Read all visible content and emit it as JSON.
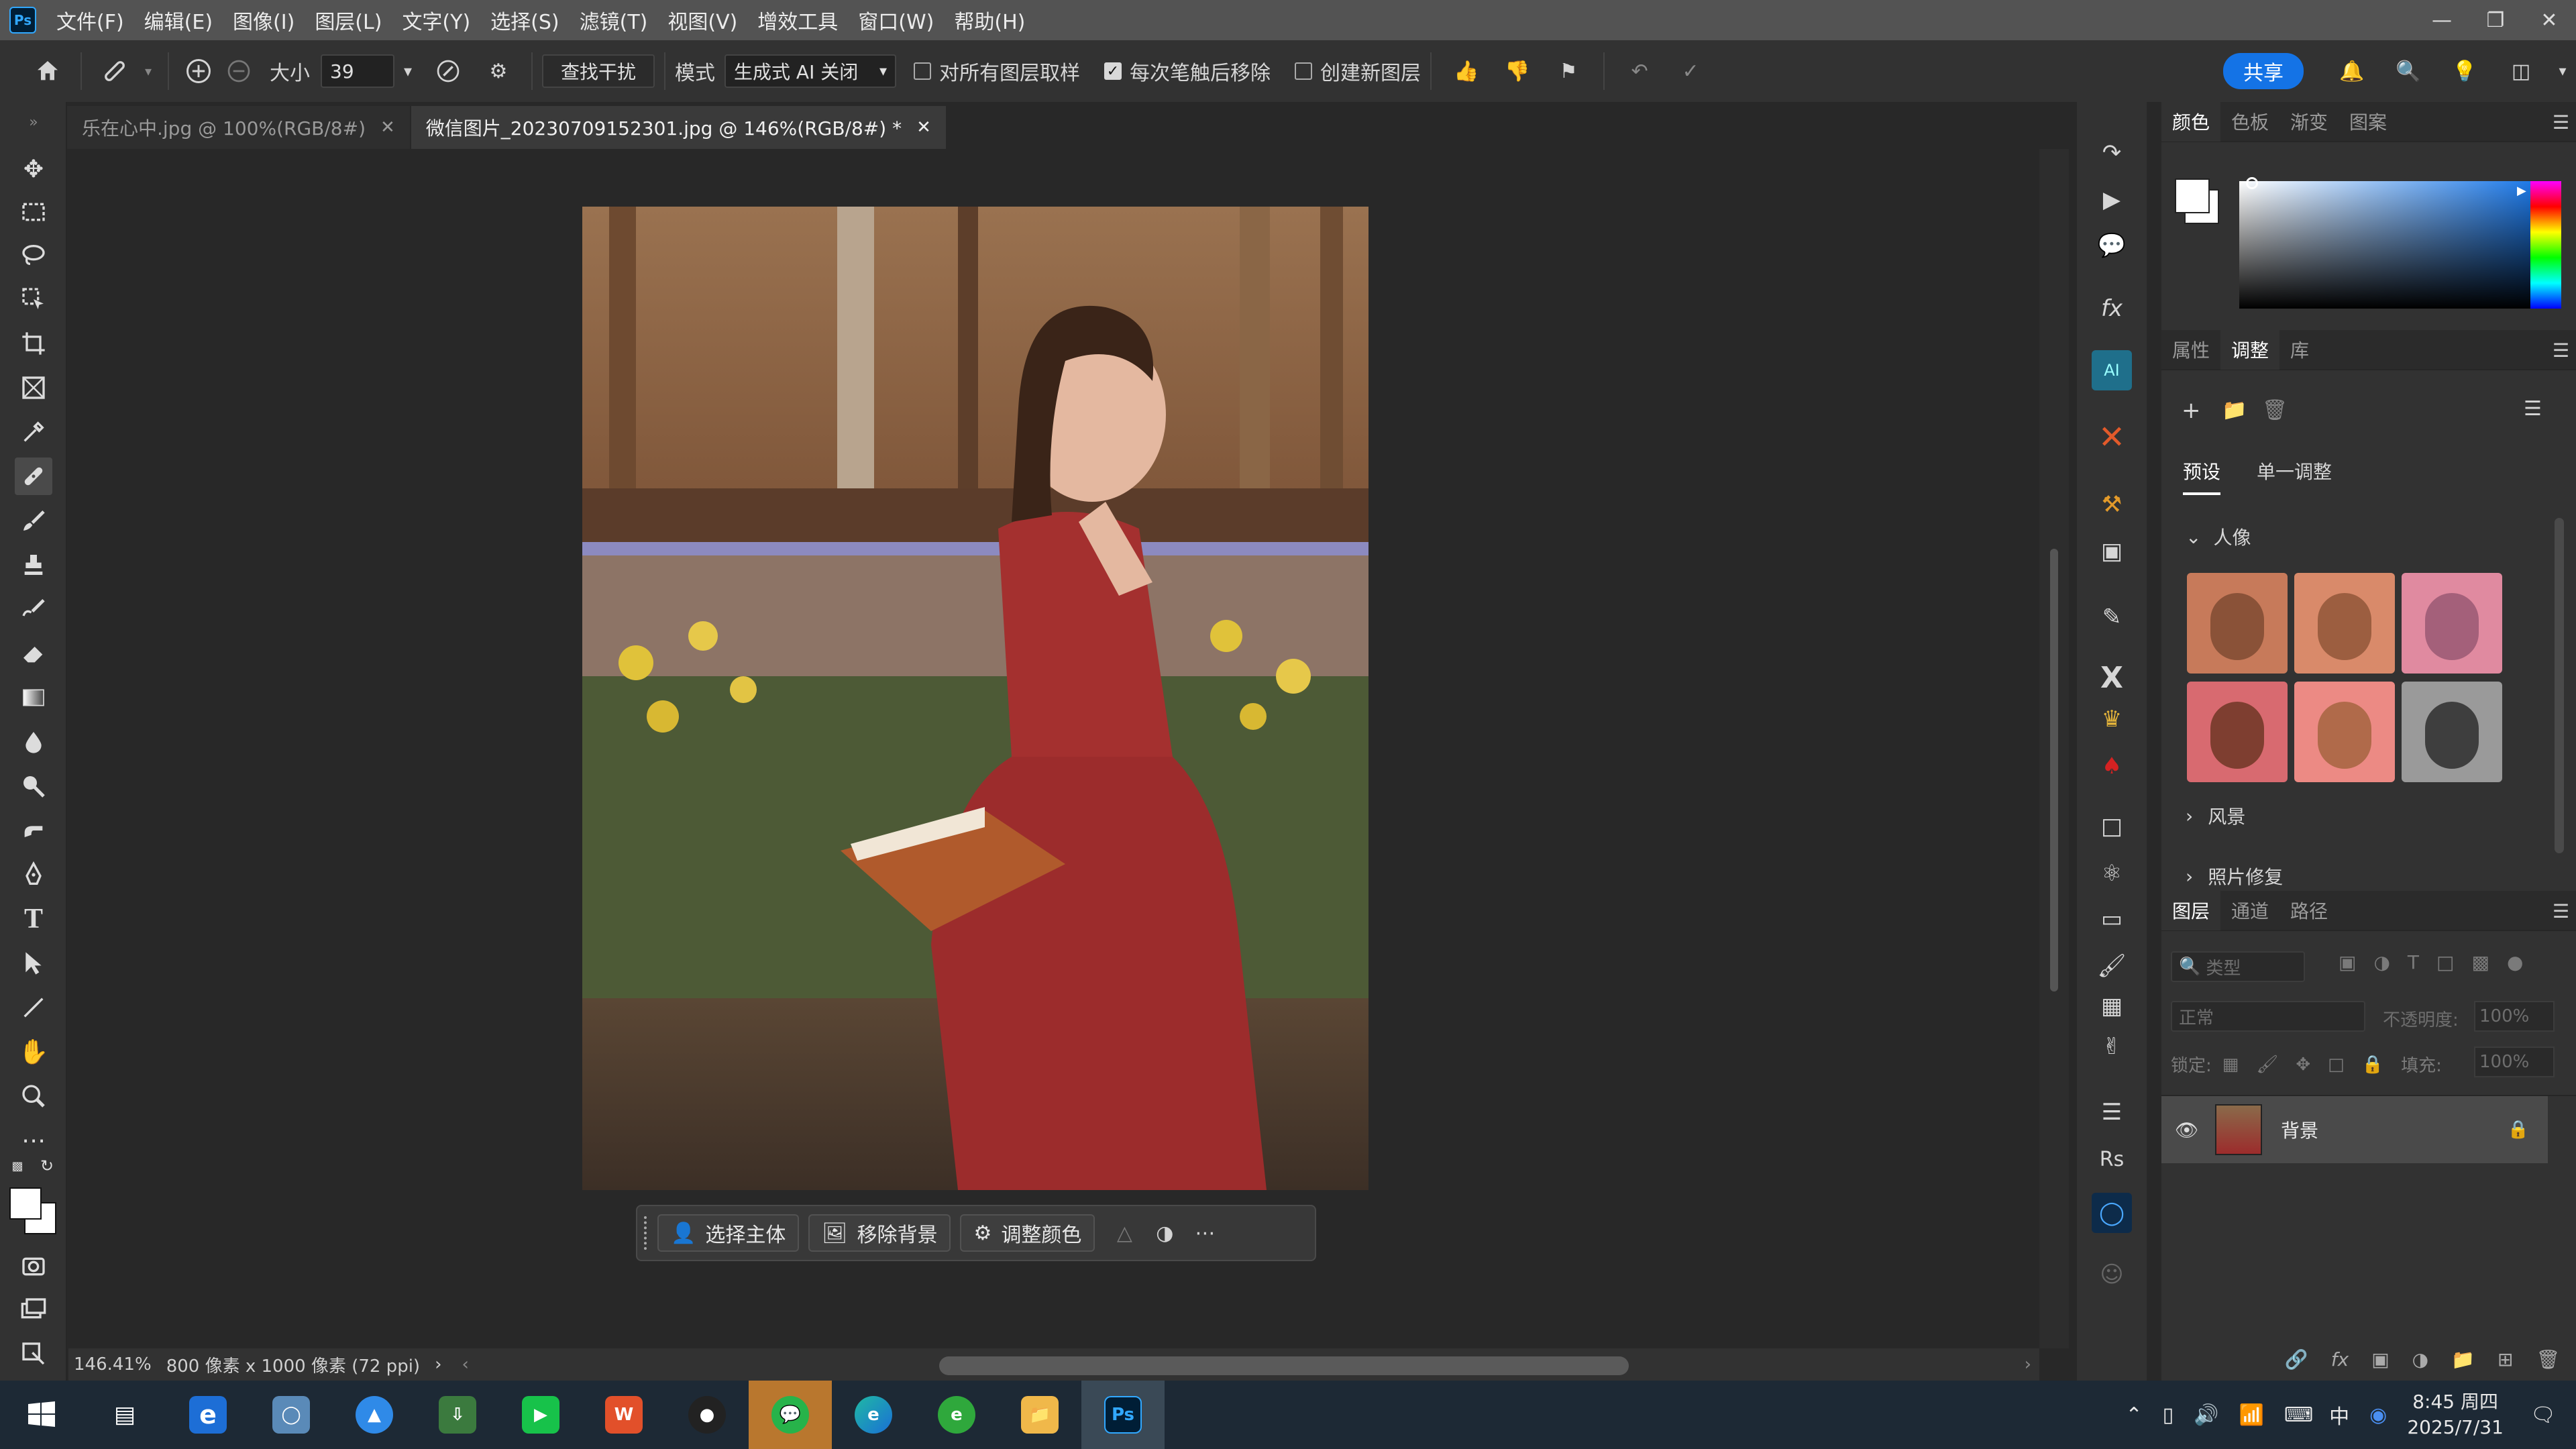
{
  "app": {
    "logo_text": "Ps",
    "menu": [
      "文件(F)",
      "编辑(E)",
      "图像(I)",
      "图层(L)",
      "文字(Y)",
      "选择(S)",
      "滤镜(T)",
      "视图(V)",
      "增效工具",
      "窗口(W)",
      "帮助(H)"
    ]
  },
  "options": {
    "size_label": "大小",
    "size_value": "39",
    "find_distractions": "查找干扰",
    "mode_label": "模式",
    "mode_value": "生成式 AI 关闭",
    "sample_all_layers": "对所有图层取样",
    "sample_all_layers_checked": false,
    "remove_after_stroke": "每次笔触后移除",
    "remove_after_stroke_checked": true,
    "create_new_layer": "创建新图层",
    "create_new_layer_checked": false,
    "share": "共享"
  },
  "tabs": [
    {
      "label": "乐在心中.jpg @ 100%(RGB/8#)",
      "active": false
    },
    {
      "label": "微信图片_20230709152301.jpg @ 146%(RGB/8#) *",
      "active": true
    }
  ],
  "context_bar": {
    "select_subject": "选择主体",
    "remove_background": "移除背景",
    "adjust_color": "调整颜色"
  },
  "status": {
    "zoom": "146.41%",
    "doc_info": "800 像素 x 1000 像素 (72 ppi)"
  },
  "color_panel": {
    "tabs": [
      "颜色",
      "色板",
      "渐变",
      "图案"
    ],
    "foreground": "#ffffff",
    "background": "#ffffff"
  },
  "adjust_panel": {
    "tabs": [
      "属性",
      "调整",
      "库"
    ],
    "subtabs": [
      "预设",
      "单一调整"
    ],
    "groups": [
      {
        "label": "人像",
        "expanded": true
      },
      {
        "label": "风景",
        "expanded": false
      },
      {
        "label": "照片修复",
        "expanded": false
      }
    ]
  },
  "layers_panel": {
    "tabs": [
      "图层",
      "通道",
      "路径"
    ],
    "filter_placeholder": "类型",
    "blend_mode": "正常",
    "opacity_label": "不透明度:",
    "opacity_value": "100%",
    "lock_label": "锁定:",
    "fill_label": "填充:",
    "fill_value": "100%",
    "layers": [
      {
        "name": "背景",
        "visible": true,
        "locked": true
      }
    ]
  },
  "taskbar": {
    "time": "8:45 周四",
    "date": "2025/7/31",
    "ime": "中"
  }
}
